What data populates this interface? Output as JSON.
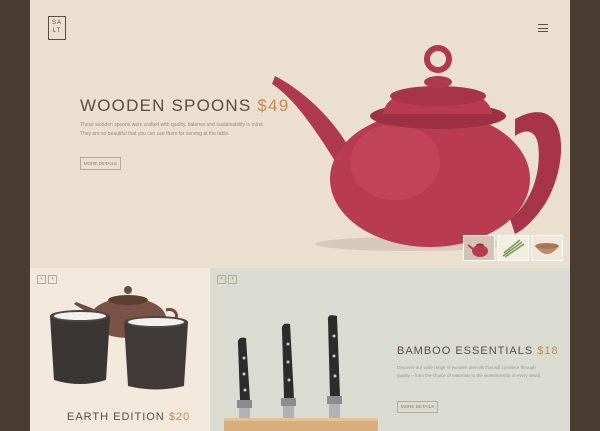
{
  "logo": {
    "line1": "SA",
    "line2": "LT"
  },
  "hero": {
    "title": "WOODEN SPOONS",
    "price": "$49",
    "description": "These wooden spoons were crafted with quality, balance and sustainability in mind. They are so beautiful that you can use them for serving at the table.",
    "button_label": "MORE DETAILS"
  },
  "earth": {
    "title": "EARTH EDITION",
    "price": "$20"
  },
  "bamboo": {
    "title": "BAMBOO ESSENTIALS",
    "price": "$18",
    "description": "Discover our wide range of wooden utensils that will convince through quality – from the choice of materials to the workmanship of every detail.",
    "button_label": "MORE DETAILS"
  },
  "nav": {
    "prev": "‹",
    "next": "›"
  },
  "colors": {
    "brand_text": "#5a4d42",
    "accent_price": "#c28a4f",
    "teapot_red": "#b83b4f",
    "page_frame": "#4a3c31"
  },
  "icons": [
    "hamburger-menu-icon",
    "prev-arrow-icon",
    "next-arrow-icon"
  ]
}
